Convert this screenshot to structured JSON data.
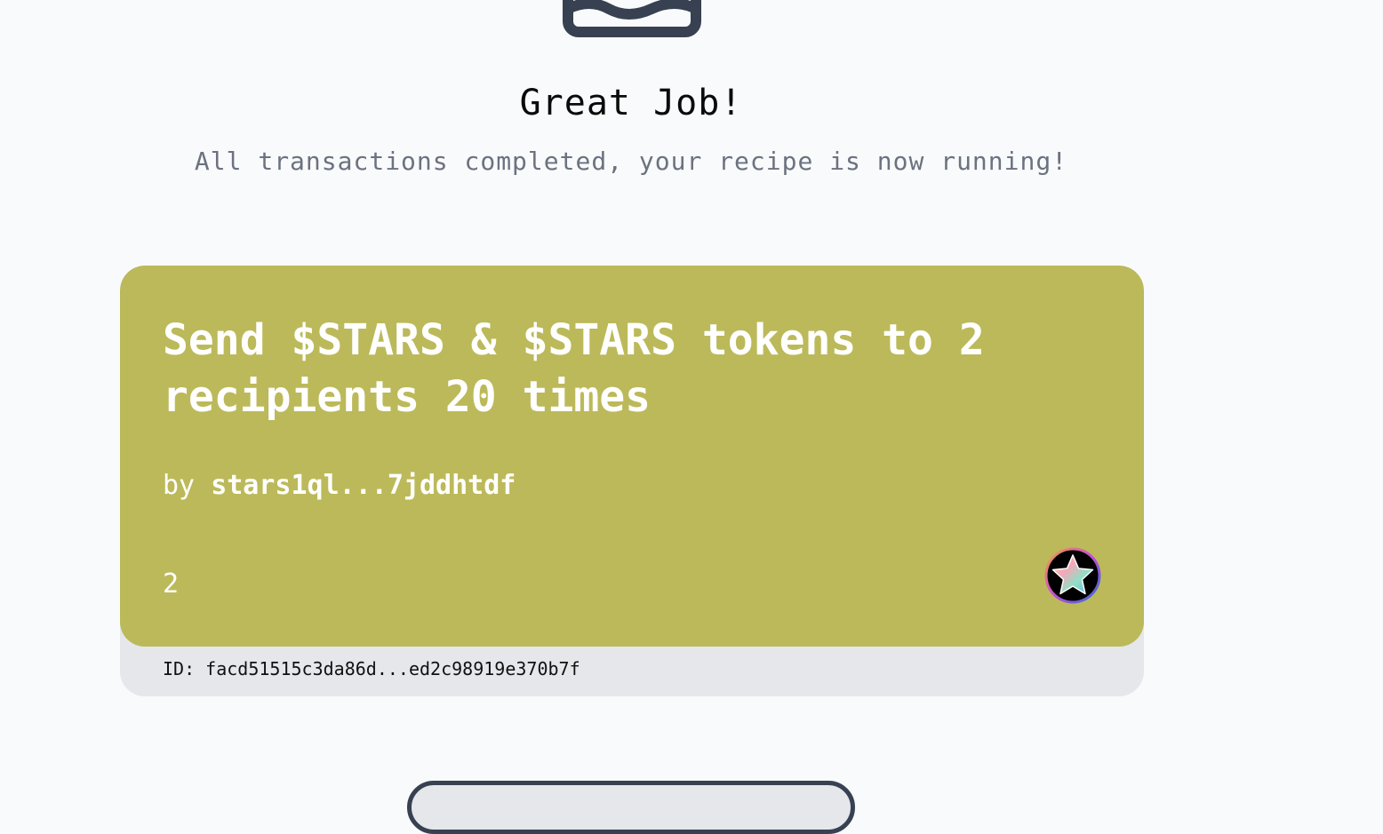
{
  "success": {
    "title": "Great Job!",
    "subtitle": "All transactions completed, your recipe is now running!"
  },
  "recipe_card": {
    "title": "Send $STARS & $STARS tokens to 2 recipients 20 times",
    "author_prefix": "by",
    "author": "stars1ql...7jddhtdf",
    "count": "2",
    "token_icon": "stars-token-icon",
    "id_label": "ID:",
    "id_value": "facd51515c3da86d...ed2c98919e370b7f",
    "colors": {
      "card_background": "#bcb95a",
      "card_footer": "#e5e7eb",
      "card_text": "#ffffff"
    }
  },
  "icons": {
    "hero": "inbox-tray-icon"
  },
  "colors": {
    "page_background": "#f9fafb",
    "muted_text": "#6b7280",
    "icon_stroke": "#374151"
  }
}
